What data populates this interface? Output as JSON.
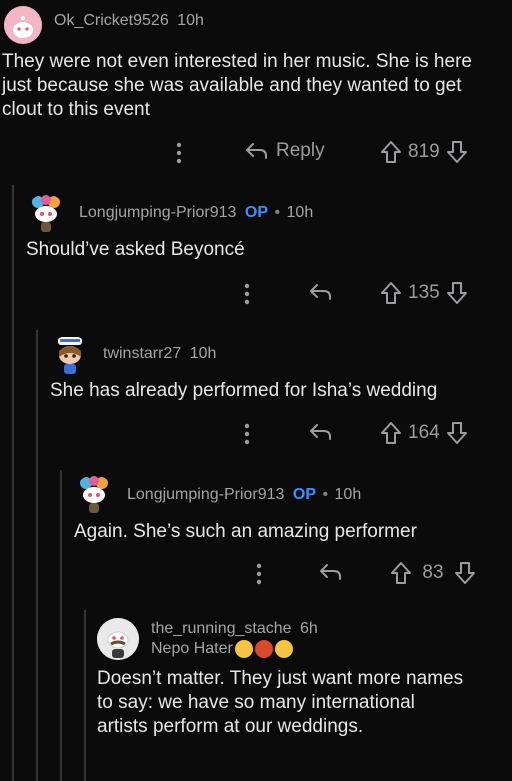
{
  "comments": [
    {
      "username": "Ok_Cricket9526",
      "time": "10h",
      "body": "They were not even interested in her music. She is here just because she was available and they wanted to get clout to this event",
      "reply_label": "Reply",
      "votes": "819",
      "avatar_color": "#e8a3b3"
    },
    {
      "username": "Longjumping-Prior913",
      "op": "OP",
      "separator": "•",
      "time": "10h",
      "body": "Should’ve asked Beyoncé",
      "votes": "135"
    },
    {
      "username": "twinstarr27",
      "time": "10h",
      "body": "She has already performed for Isha’s wedding",
      "votes": "164"
    },
    {
      "username": "Longjumping-Prior913",
      "op": "OP",
      "separator": "•",
      "time": "10h",
      "body": "Again. She’s such an amazing performer",
      "votes": "83"
    },
    {
      "username": "the_running_stache",
      "time": "6h",
      "flair": "Nepo Hater",
      "body": "Doesn’t matter. They just want more names to say: we have so many international artists perform at our weddings."
    }
  ],
  "colors": {
    "background": "#0b0b0b",
    "op": "#3d8eff",
    "meta": "#a3a5a7",
    "thread_line": "#343536"
  },
  "icons": {
    "more": "more-vertical-icon",
    "reply": "reply-arrow-icon",
    "upvote": "upvote-arrow-icon",
    "downvote": "downvote-arrow-icon"
  }
}
